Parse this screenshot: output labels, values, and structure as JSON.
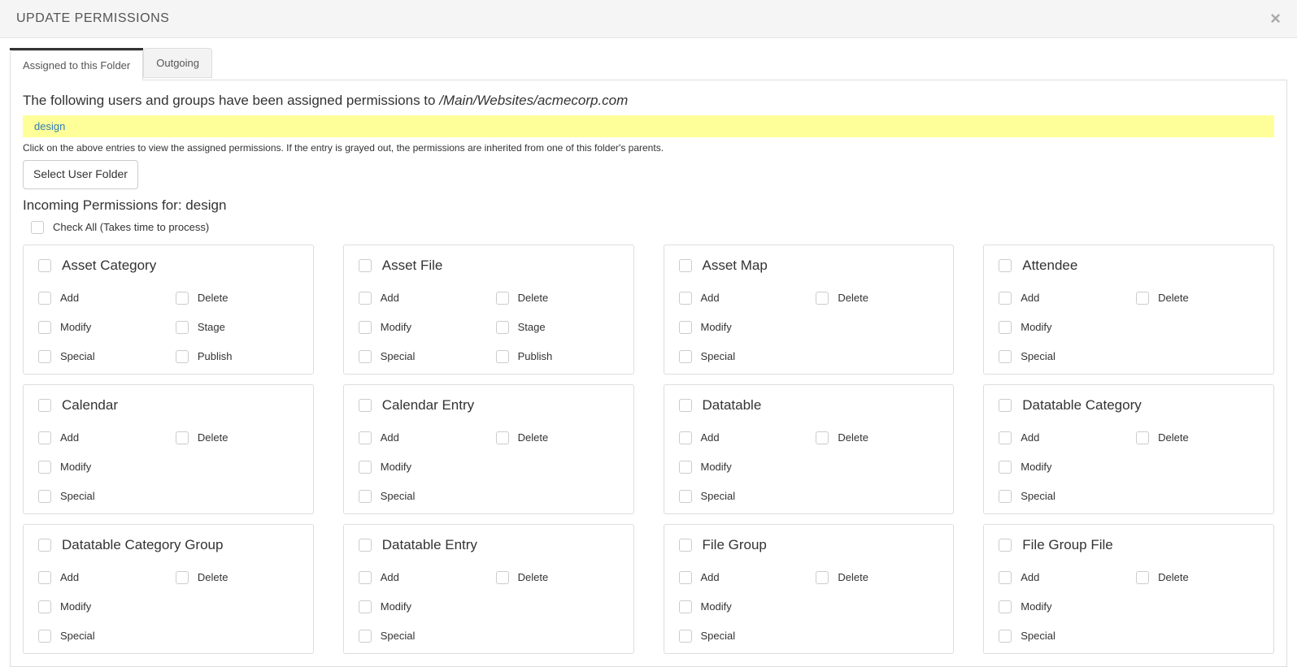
{
  "header": {
    "title": "UPDATE PERMISSIONS"
  },
  "tabs": [
    {
      "label": "Assigned to this Folder",
      "active": true
    },
    {
      "label": "Outgoing",
      "active": false
    }
  ],
  "intro": {
    "prefix": "The following users and groups have been assigned permissions to ",
    "path": "/Main/Websites/acmecorp.com"
  },
  "principals": [
    {
      "name": "design"
    }
  ],
  "help_text": "Click on the above entries to view the assigned permissions. If the entry is grayed out, the permissions are inherited from one of this folder's parents.",
  "select_user_folder_label": "Select User Folder",
  "incoming_heading_prefix": "Incoming Permissions for: ",
  "incoming_for": "design",
  "check_all_label": "Check All (Takes time to process)",
  "action_labels": {
    "add": "Add",
    "delete": "Delete",
    "modify": "Modify",
    "stage": "Stage",
    "special": "Special",
    "publish": "Publish"
  },
  "cards": [
    {
      "title": "Asset Category",
      "actions": [
        "add",
        "delete",
        "modify",
        "stage",
        "special",
        "publish"
      ]
    },
    {
      "title": "Asset File",
      "actions": [
        "add",
        "delete",
        "modify",
        "stage",
        "special",
        "publish"
      ]
    },
    {
      "title": "Asset Map",
      "actions": [
        "add",
        "delete",
        "modify",
        "special"
      ]
    },
    {
      "title": "Attendee",
      "actions": [
        "add",
        "delete",
        "modify",
        "special"
      ]
    },
    {
      "title": "Calendar",
      "actions": [
        "add",
        "delete",
        "modify",
        "special"
      ]
    },
    {
      "title": "Calendar Entry",
      "actions": [
        "add",
        "delete",
        "modify",
        "special"
      ]
    },
    {
      "title": "Datatable",
      "actions": [
        "add",
        "delete",
        "modify",
        "special"
      ]
    },
    {
      "title": "Datatable Category",
      "actions": [
        "add",
        "delete",
        "modify",
        "special"
      ]
    },
    {
      "title": "Datatable Category Group",
      "actions": [
        "add",
        "delete",
        "modify",
        "special"
      ]
    },
    {
      "title": "Datatable Entry",
      "actions": [
        "add",
        "delete",
        "modify",
        "special"
      ]
    },
    {
      "title": "File Group",
      "actions": [
        "add",
        "delete",
        "modify",
        "special"
      ]
    },
    {
      "title": "File Group File",
      "actions": [
        "add",
        "delete",
        "modify",
        "special"
      ]
    }
  ]
}
